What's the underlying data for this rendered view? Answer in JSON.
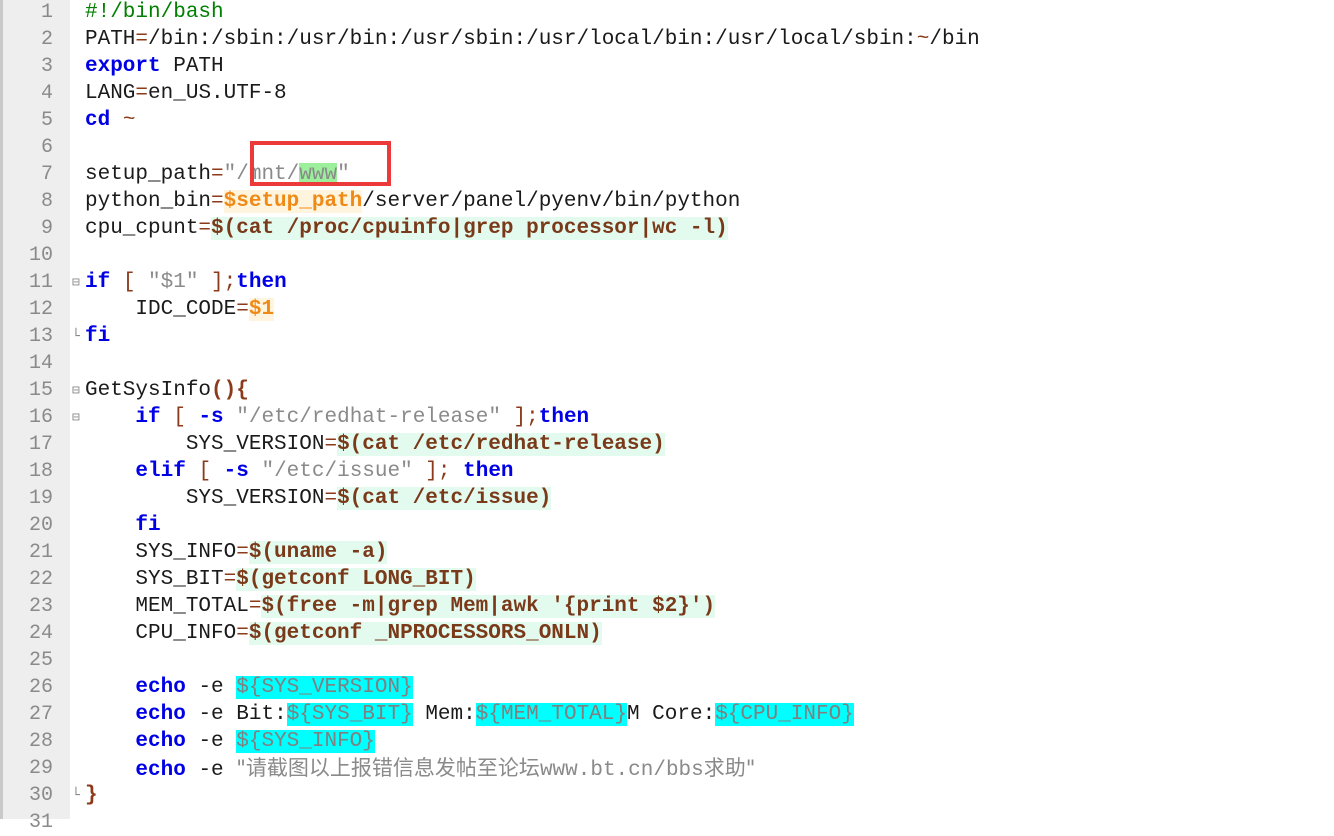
{
  "editor": {
    "line_numbers": [
      "1",
      "2",
      "3",
      "4",
      "5",
      "6",
      "7",
      "8",
      "9",
      "10",
      "11",
      "12",
      "13",
      "14",
      "15",
      "16",
      "17",
      "18",
      "19",
      "20",
      "21",
      "22",
      "23",
      "24",
      "25",
      "26",
      "27",
      "28",
      "29",
      "30",
      "31"
    ],
    "code": {
      "l1": "#!/bin/bash",
      "l2a": "PATH",
      "l2b": "=",
      "l2c": "/bin:/sbin:/usr/bin:/usr/sbin:/usr/local/bin:/usr/local/sbin:",
      "l2d": "~",
      "l2e": "/bin",
      "l3a": "export",
      "l3b": " PATH",
      "l4a": "LANG",
      "l4b": "=",
      "l4c": "en_US.UTF-8",
      "l5a": "cd",
      "l5b": " ~",
      "l7a": "setup_path",
      "l7b": "=",
      "l7c": "\"/mnt/",
      "l7d": "www",
      "l7e": "\"",
      "l8a": "python_bin",
      "l8b": "=",
      "l8c": "$setup_path",
      "l8d": "/server/panel/pyenv/bin/python",
      "l9a": "cpu_cpunt",
      "l9b": "=",
      "l9c": "$(cat /proc/cpuinfo|grep processor|wc -l)",
      "l11a": "if",
      "l11b": " [ ",
      "l11c": "\"$1\"",
      "l11d": " ];",
      "l11e": "then",
      "l12a": "    IDC_CODE",
      "l12b": "=",
      "l12c": "$1",
      "l13": "fi",
      "l15a": "GetSysInfo",
      "l15b": "(){",
      "l16a": "    ",
      "l16b": "if",
      "l16c": " [ ",
      "l16d": "-s",
      "l16e": " \"/etc/redhat-release\"",
      "l16f": " ];",
      "l16g": "then",
      "l17a": "        SYS_VERSION",
      "l17b": "=",
      "l17c": "$(cat /etc/redhat-release)",
      "l18a": "    ",
      "l18b": "elif",
      "l18c": " [ ",
      "l18d": "-s",
      "l18e": " \"/etc/issue\"",
      "l18f": " ]; ",
      "l18g": "then",
      "l19a": "        SYS_VERSION",
      "l19b": "=",
      "l19c": "$(cat /etc/issue)",
      "l20a": "    ",
      "l20b": "fi",
      "l21a": "    SYS_INFO",
      "l21b": "=",
      "l21c": "$(uname -a)",
      "l22a": "    SYS_BIT",
      "l22b": "=",
      "l22c": "$(getconf LONG_BIT)",
      "l23a": "    MEM_TOTAL",
      "l23b": "=",
      "l23c": "$(free -m|grep Mem|awk '{print $2}')",
      "l24a": "    CPU_INFO",
      "l24b": "=",
      "l24c": "$(getconf _NPROCESSORS_ONLN)",
      "l26a": "    ",
      "l26b": "echo",
      "l26c": " -e ",
      "l26d": "${SYS_VERSION}",
      "l27a": "    ",
      "l27b": "echo",
      "l27c": " -e ",
      "l27d": "Bit:",
      "l27e": "${SYS_BIT}",
      "l27f": " Mem:",
      "l27g": "${MEM_TOTAL}",
      "l27h": "M Core:",
      "l27i": "${CPU_INFO}",
      "l28a": "    ",
      "l28b": "echo",
      "l28c": " -e ",
      "l28d": "${SYS_INFO}",
      "l29a": "    ",
      "l29b": "echo",
      "l29c": " -e ",
      "l29d": "\"请截图以上报错信息发帖至论坛",
      "l29e": "www.bt.cn/bbs",
      "l29f": "求助\"",
      "l30": "}"
    },
    "fold_markers": [
      "⊟",
      "⊟",
      "⊟",
      "└",
      "└"
    ],
    "highlight_color": "#ec3a3a"
  }
}
